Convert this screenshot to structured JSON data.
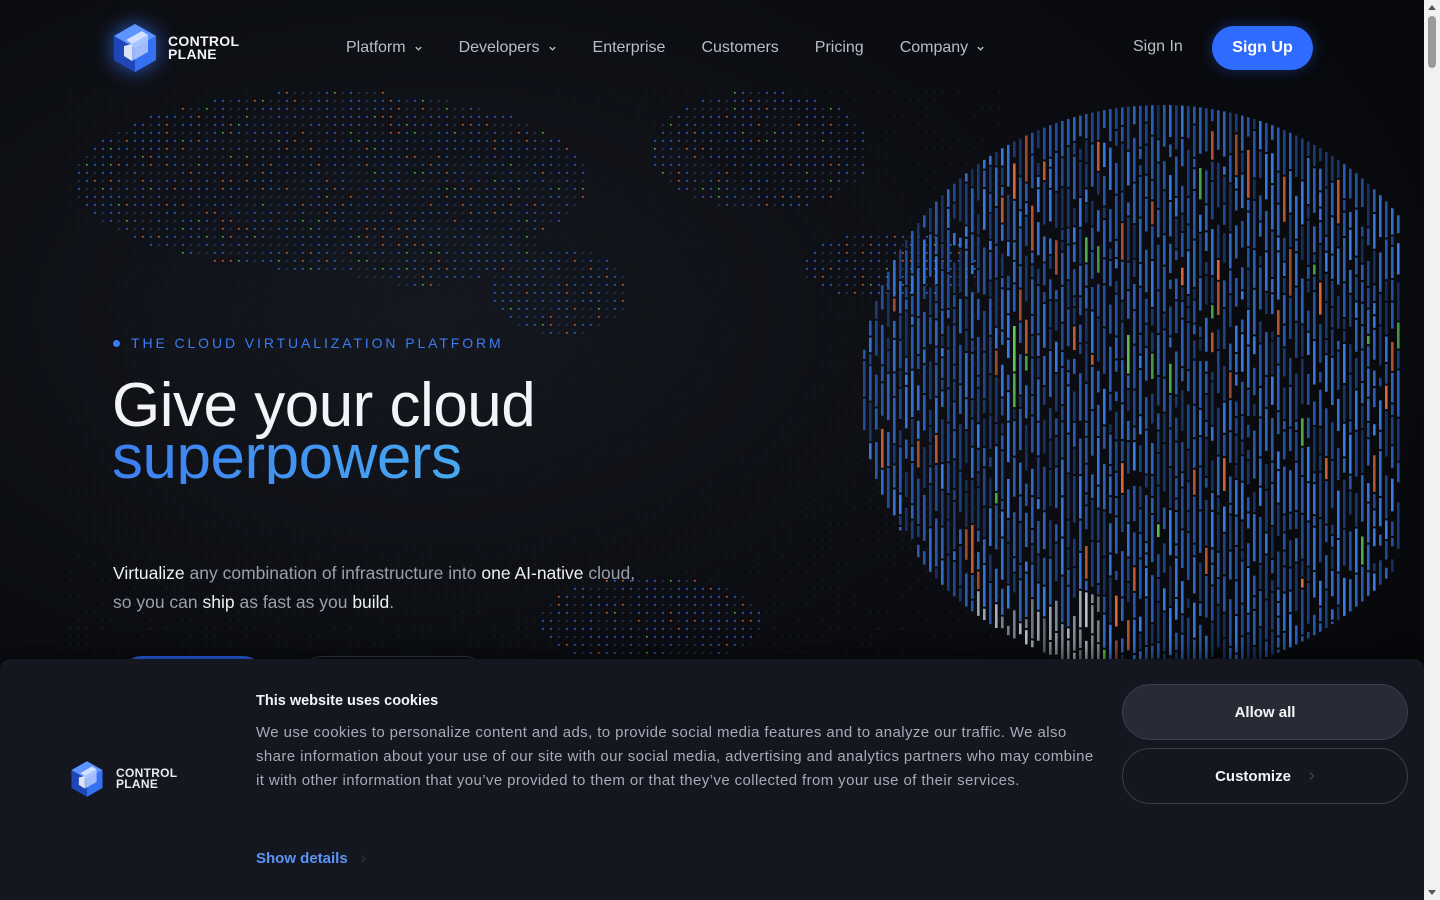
{
  "header": {
    "logo": {
      "line1": "CONTROL",
      "line2": "PLANE",
      "icon": "cube-logo-icon"
    },
    "nav": [
      {
        "label": "Platform",
        "has_dropdown": true
      },
      {
        "label": "Developers",
        "has_dropdown": true
      },
      {
        "label": "Enterprise",
        "has_dropdown": false
      },
      {
        "label": "Customers",
        "has_dropdown": false
      },
      {
        "label": "Pricing",
        "has_dropdown": false
      },
      {
        "label": "Company",
        "has_dropdown": true
      }
    ],
    "sign_in": "Sign In",
    "sign_up": "Sign Up"
  },
  "hero": {
    "eyebrow": "THE CLOUD VIRTUALIZATION PLATFORM",
    "headline_line1": "Give your cloud",
    "headline_line2": "superpowers",
    "subcopy": {
      "w1": "Virtualize",
      "t1": " any combination of infrastructure into ",
      "w2": "one AI-native",
      "t2": " cloud, so you can ",
      "w3": "ship",
      "t3": " as fast as you ",
      "w4": "build",
      "t4": "."
    }
  },
  "cookie_banner": {
    "logo": {
      "line1": "CONTROL",
      "line2": "PLANE"
    },
    "title": "This website uses cookies",
    "body": "We use cookies to personalize content and ads, to provide social media features and to analyze our traffic. We also share information about your use of our site with our social media, advertising and analytics partners who may combine it with other information that you’ve provided to them or that they’ve collected from your use of their services.",
    "show_details": "Show details",
    "allow_all": "Allow all",
    "customize": "Customize"
  },
  "colors": {
    "accent": "#2f6bff",
    "eyebrow": "#3b7cf5",
    "headline_gradient_start": "#3d7ff2",
    "headline_gradient_end": "#49b1f0",
    "banner_bg": "#141720",
    "page_bg": "#08090d"
  }
}
